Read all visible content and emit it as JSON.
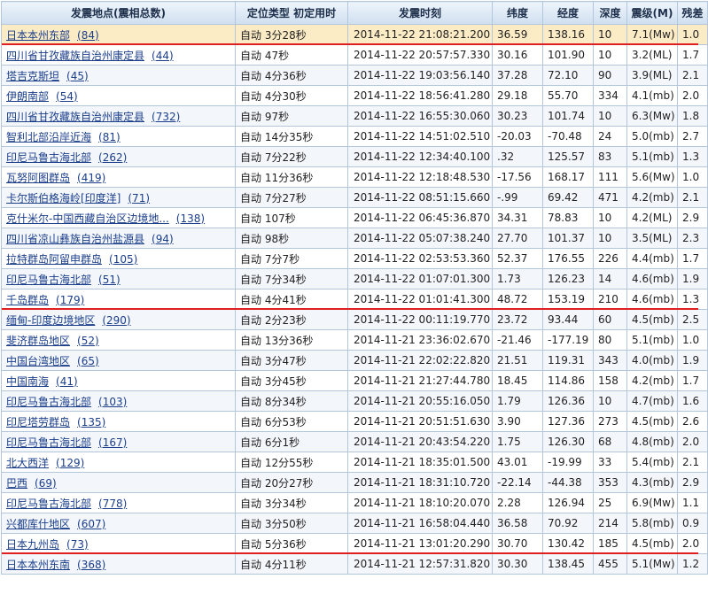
{
  "table": {
    "headers": [
      "发震地点(震相总数)",
      "定位类型 初定用时",
      "发震时刻",
      "纬度",
      "经度",
      "深度",
      "震级(M)",
      "残差"
    ],
    "rows": [
      {
        "loc": "日本本州东部",
        "count": "(84)",
        "type": "自动 3分28秒",
        "time": "2014-11-22 21:08:21.200",
        "lat": "36.59",
        "lon": "138.16",
        "depth": "10",
        "mag": "7.1(Mw)",
        "res": "1.0"
      },
      {
        "loc": "四川省甘孜藏族自治州康定县",
        "count": "(44)",
        "type": "自动 47秒",
        "time": "2014-11-22 20:57:57.330",
        "lat": "30.16",
        "lon": "101.90",
        "depth": "10",
        "mag": "3.2(ML)",
        "res": "1.7"
      },
      {
        "loc": "塔吉克斯坦",
        "count": "(45)",
        "type": "自动 4分36秒",
        "time": "2014-11-22 19:03:56.140",
        "lat": "37.28",
        "lon": "72.10",
        "depth": "90",
        "mag": "3.9(ML)",
        "res": "2.1"
      },
      {
        "loc": "伊朗南部",
        "count": "(54)",
        "type": "自动 4分30秒",
        "time": "2014-11-22 18:56:41.280",
        "lat": "29.18",
        "lon": "55.70",
        "depth": "334",
        "mag": "4.1(mb)",
        "res": "2.0"
      },
      {
        "loc": "四川省甘孜藏族自治州康定县",
        "count": "(732)",
        "type": "自动 97秒",
        "time": "2014-11-22 16:55:30.060",
        "lat": "30.23",
        "lon": "101.74",
        "depth": "10",
        "mag": "6.3(Mw)",
        "res": "1.8"
      },
      {
        "loc": "智利北部沿岸近海",
        "count": "(81)",
        "type": "自动 14分35秒",
        "time": "2014-11-22 14:51:02.510",
        "lat": "-20.03",
        "lon": "-70.48",
        "depth": "24",
        "mag": "5.0(mb)",
        "res": "2.7"
      },
      {
        "loc": "印尼马鲁古海北部",
        "count": "(262)",
        "type": "自动 7分22秒",
        "time": "2014-11-22 12:34:40.100",
        "lat": ".32",
        "lon": "125.57",
        "depth": "83",
        "mag": "5.1(mb)",
        "res": "1.3"
      },
      {
        "loc": "瓦努阿图群岛",
        "count": "(419)",
        "type": "自动 11分36秒",
        "time": "2014-11-22 12:18:48.530",
        "lat": "-17.56",
        "lon": "168.17",
        "depth": "111",
        "mag": "5.6(Mw)",
        "res": "1.0"
      },
      {
        "loc": "卡尔斯伯格海岭[印度洋]",
        "count": "(71)",
        "type": "自动 7分27秒",
        "time": "2014-11-22 08:51:15.660",
        "lat": "-.99",
        "lon": "69.42",
        "depth": "471",
        "mag": "4.2(mb)",
        "res": "2.1"
      },
      {
        "loc": "克什米尔-中国西藏自治区边境地...",
        "count": "(138)",
        "type": "自动 107秒",
        "time": "2014-11-22 06:45:36.870",
        "lat": "34.31",
        "lon": "78.83",
        "depth": "10",
        "mag": "4.2(ML)",
        "res": "2.9"
      },
      {
        "loc": "四川省凉山彝族自治州盐源县",
        "count": "(94)",
        "type": "自动 98秒",
        "time": "2014-11-22 05:07:38.240",
        "lat": "27.70",
        "lon": "101.37",
        "depth": "10",
        "mag": "3.5(ML)",
        "res": "2.3"
      },
      {
        "loc": "拉特群岛阿留申群岛",
        "count": "(105)",
        "type": "自动 7分7秒",
        "time": "2014-11-22 02:53:53.360",
        "lat": "52.37",
        "lon": "176.55",
        "depth": "226",
        "mag": "4.4(mb)",
        "res": "1.7"
      },
      {
        "loc": "印尼马鲁古海北部",
        "count": "(51)",
        "type": "自动 7分34秒",
        "time": "2014-11-22 01:07:01.300",
        "lat": "1.73",
        "lon": "126.23",
        "depth": "14",
        "mag": "4.6(mb)",
        "res": "1.9"
      },
      {
        "loc": "千岛群岛",
        "count": "(179)",
        "type": "自动 4分41秒",
        "time": "2014-11-22 01:01:41.300",
        "lat": "48.72",
        "lon": "153.19",
        "depth": "210",
        "mag": "4.6(mb)",
        "res": "1.3"
      },
      {
        "loc": "缅甸-印度边境地区",
        "count": "(290)",
        "type": "自动 2分23秒",
        "time": "2014-11-22 00:11:19.770",
        "lat": "23.72",
        "lon": "93.44",
        "depth": "60",
        "mag": "4.5(mb)",
        "res": "2.5"
      },
      {
        "loc": "斐济群岛地区",
        "count": "(52)",
        "type": "自动 13分36秒",
        "time": "2014-11-21 23:36:02.670",
        "lat": "-21.46",
        "lon": "-177.19",
        "depth": "80",
        "mag": "5.1(mb)",
        "res": "1.0"
      },
      {
        "loc": "中国台湾地区",
        "count": "(65)",
        "type": "自动 3分47秒",
        "time": "2014-11-21 22:02:22.820",
        "lat": "21.51",
        "lon": "119.31",
        "depth": "343",
        "mag": "4.0(mb)",
        "res": "1.9"
      },
      {
        "loc": "中国南海",
        "count": "(41)",
        "type": "自动 3分45秒",
        "time": "2014-11-21 21:27:44.780",
        "lat": "18.45",
        "lon": "114.86",
        "depth": "158",
        "mag": "4.2(mb)",
        "res": "1.7"
      },
      {
        "loc": "印尼马鲁古海北部",
        "count": "(103)",
        "type": "自动 8分34秒",
        "time": "2014-11-21 20:55:16.050",
        "lat": "1.79",
        "lon": "126.36",
        "depth": "10",
        "mag": "4.7(mb)",
        "res": "1.6"
      },
      {
        "loc": "印尼塔劳群岛",
        "count": "(135)",
        "type": "自动 6分53秒",
        "time": "2014-11-21 20:51:51.630",
        "lat": "3.90",
        "lon": "127.36",
        "depth": "273",
        "mag": "4.5(mb)",
        "res": "2.6"
      },
      {
        "loc": "印尼马鲁古海北部",
        "count": "(167)",
        "type": "自动 6分1秒",
        "time": "2014-11-21 20:43:54.220",
        "lat": "1.75",
        "lon": "126.30",
        "depth": "68",
        "mag": "4.8(mb)",
        "res": "2.0"
      },
      {
        "loc": "北大西洋",
        "count": "(129)",
        "type": "自动 12分55秒",
        "time": "2014-11-21 18:35:01.500",
        "lat": "43.01",
        "lon": "-19.99",
        "depth": "33",
        "mag": "5.4(mb)",
        "res": "2.1"
      },
      {
        "loc": "巴西",
        "count": "(69)",
        "type": "自动 20分27秒",
        "time": "2014-11-21 18:31:10.720",
        "lat": "-22.14",
        "lon": "-44.38",
        "depth": "353",
        "mag": "4.3(mb)",
        "res": "2.9"
      },
      {
        "loc": "印尼马鲁古海北部",
        "count": "(778)",
        "type": "自动 3分34秒",
        "time": "2014-11-21 18:10:20.070",
        "lat": "2.28",
        "lon": "126.94",
        "depth": "25",
        "mag": "6.9(Mw)",
        "res": "1.1"
      },
      {
        "loc": "兴都库什地区",
        "count": "(607)",
        "type": "自动 3分50秒",
        "time": "2014-11-21 16:58:04.440",
        "lat": "36.58",
        "lon": "70.92",
        "depth": "214",
        "mag": "5.8(mb)",
        "res": "0.9"
      },
      {
        "loc": "日本九州岛",
        "count": "(73)",
        "type": "自动 5分36秒",
        "time": "2014-11-21 13:01:20.290",
        "lat": "30.70",
        "lon": "130.42",
        "depth": "185",
        "mag": "4.5(mb)",
        "res": "2.0"
      },
      {
        "loc": "日本本州东南",
        "count": "(368)",
        "type": "自动 4分11秒",
        "time": "2014-11-21 12:57:31.820",
        "lat": "30.30",
        "lon": "138.45",
        "depth": "455",
        "mag": "5.1(Mw)",
        "res": "1.2"
      }
    ]
  },
  "colors": {
    "header_bg": "#cfdff0",
    "border": "#b3c6dc",
    "link": "#1b3e8a",
    "highlight_row": "#fcecc6",
    "red_marker": "#e02020"
  }
}
